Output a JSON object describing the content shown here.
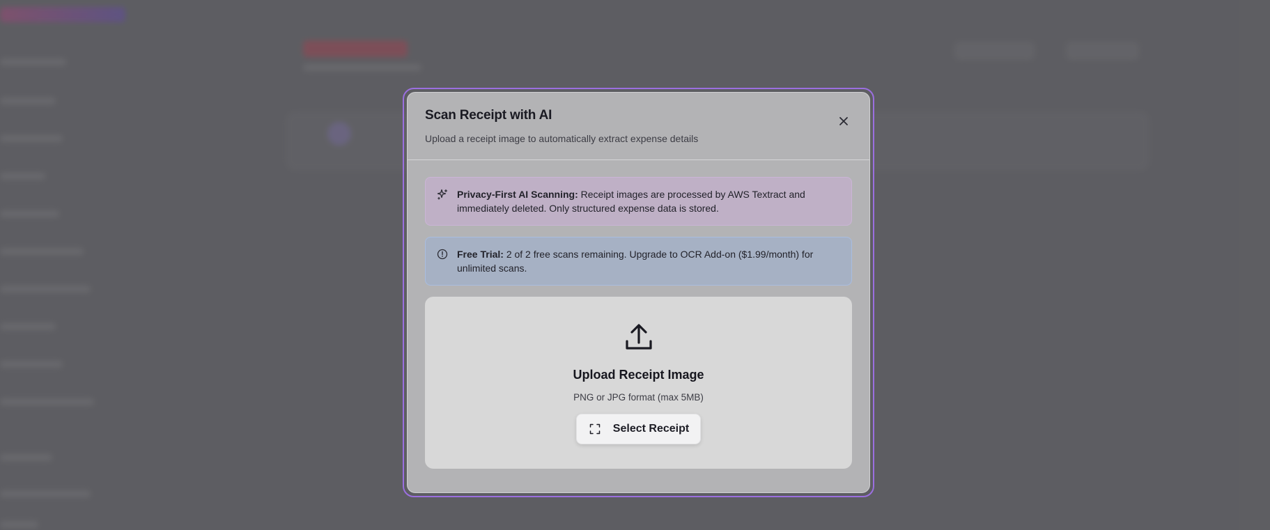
{
  "modal": {
    "title": "Scan Receipt with AI",
    "description": "Upload a receipt image to automatically extract expense details",
    "close_icon": "close-icon"
  },
  "privacy_notice": {
    "icon": "sparkles-icon",
    "label": "Privacy-First AI Scanning:",
    "text": "Receipt images are processed by AWS Textract and immediately deleted. Only structured expense data is stored."
  },
  "trial_notice": {
    "icon": "info-icon",
    "label": "Free Trial:",
    "text": "2 of 2 free scans remaining. Upgrade to OCR Add-on ($1.99/month) for unlimited scans."
  },
  "upload": {
    "icon": "upload-icon",
    "title": "Upload Receipt Image",
    "hint": "PNG or JPG format (max 5MB)",
    "button_icon": "scan-icon",
    "button_label": "Select Receipt"
  },
  "colors": {
    "modal_border": "#9b6fe0",
    "privacy_bg": "#bfb0c6",
    "trial_bg": "#a6b1c4"
  }
}
